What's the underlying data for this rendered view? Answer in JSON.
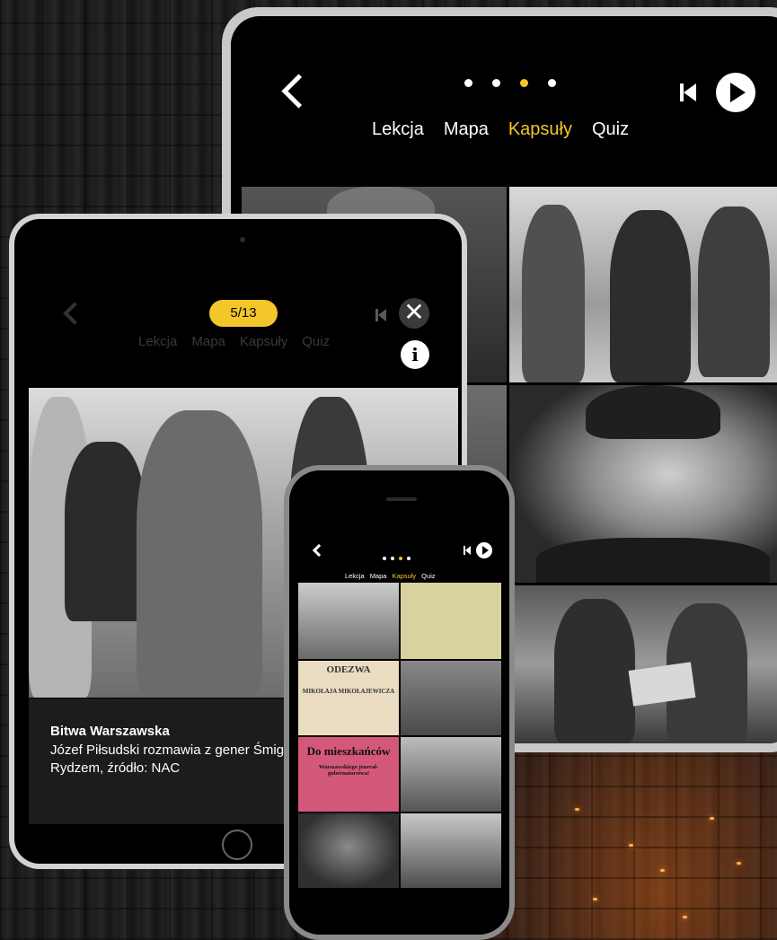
{
  "big_tablet": {
    "tabs": [
      "Lekcja",
      "Mapa",
      "Kapsuły",
      "Quiz"
    ],
    "active_tab_index": 2,
    "page_dots": 4,
    "active_dot_index": 2,
    "icons": [
      "back-icon",
      "previous-icon",
      "play-icon"
    ]
  },
  "small_tablet": {
    "counter": "5/13",
    "tabs": [
      "Lekcja",
      "Mapa",
      "Kapsuły",
      "Quiz"
    ],
    "caption_title": "Bitwa Warszawska",
    "caption_text": "Józef Piłsudski rozmawia z gener Śmigłym-Rydzem, źródło: NAC",
    "icons": [
      "back-icon",
      "previous-icon",
      "close-icon",
      "info-icon"
    ]
  },
  "phone": {
    "tabs": [
      "Lekcja",
      "Mapa",
      "Kapsuły",
      "Quiz"
    ],
    "active_tab_index": 2,
    "poster_odezwa_title": "ODEZWA",
    "poster_odezwa_name": "MIKOŁAJA MIKOŁAJEWICZA",
    "poster_pink_title": "Do mieszkańców",
    "poster_pink_sub": "Warszawskiego jenerał-gubernatorstwa!"
  },
  "colors": {
    "accent": "#f3c62a",
    "screen_bg": "#000000",
    "text": "#ffffff"
  }
}
